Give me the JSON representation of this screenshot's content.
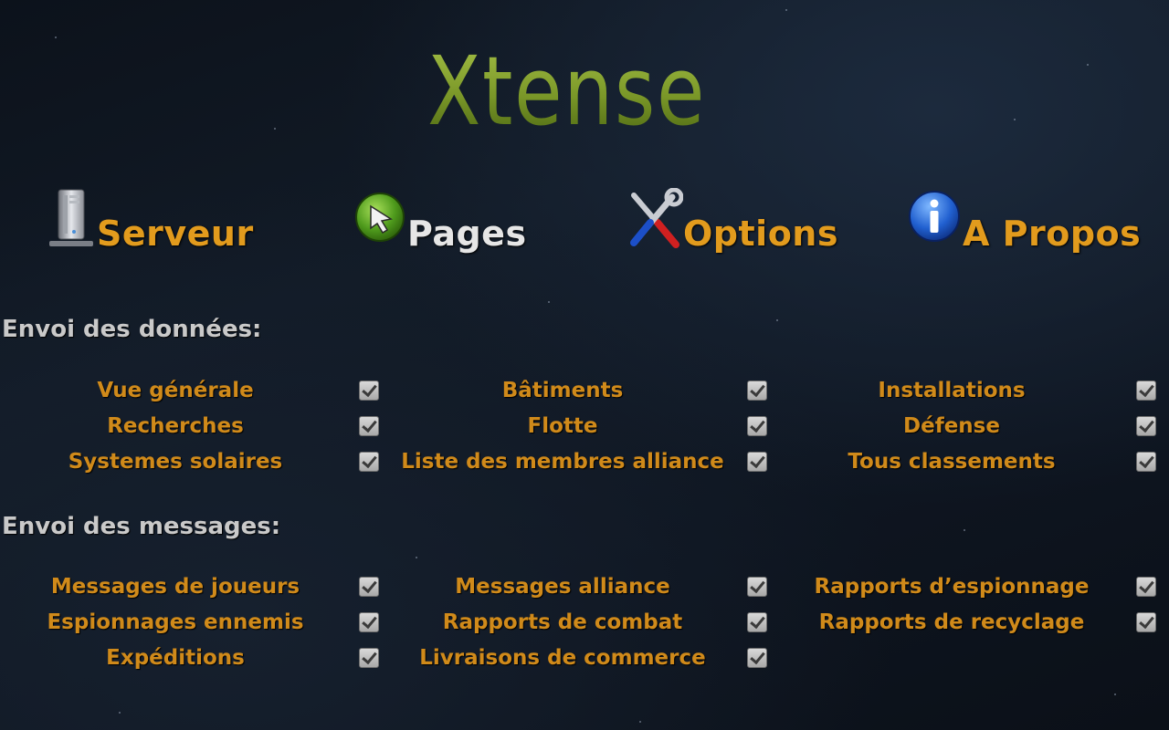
{
  "app": {
    "logo_text": "Xtense"
  },
  "nav": {
    "tabs": [
      {
        "label": "Serveur",
        "icon": "server-icon",
        "active": false
      },
      {
        "label": "Pages",
        "icon": "pages-icon",
        "active": true
      },
      {
        "label": "Options",
        "icon": "tools-icon",
        "active": false
      },
      {
        "label": "A Propos",
        "icon": "info-icon",
        "active": false
      }
    ]
  },
  "colors": {
    "accent": "#e29b1d",
    "option_label": "#d08a1a",
    "active_tab": "#e6e6e6",
    "section_title": "#c9c9c9",
    "logo": "#7e9a2c"
  },
  "sections": {
    "data": {
      "title": "Envoi des données:",
      "options": [
        {
          "label": "Vue générale",
          "checked": true
        },
        {
          "label": "Bâtiments",
          "checked": true
        },
        {
          "label": "Installations",
          "checked": true
        },
        {
          "label": "Recherches",
          "checked": true
        },
        {
          "label": "Flotte",
          "checked": true
        },
        {
          "label": "Défense",
          "checked": true
        },
        {
          "label": "Systemes solaires",
          "checked": true
        },
        {
          "label": "Liste des membres alliance",
          "checked": true
        },
        {
          "label": "Tous classements",
          "checked": true
        }
      ]
    },
    "messages": {
      "title": "Envoi des messages:",
      "options": [
        {
          "label": "Messages de joueurs",
          "checked": true
        },
        {
          "label": "Messages alliance",
          "checked": true
        },
        {
          "label": "Rapports d’espionnage",
          "checked": true
        },
        {
          "label": "Espionnages ennemis",
          "checked": true
        },
        {
          "label": "Rapports de combat",
          "checked": true
        },
        {
          "label": "Rapports de recyclage",
          "checked": true
        },
        {
          "label": "Expéditions",
          "checked": true
        },
        {
          "label": "Livraisons de commerce",
          "checked": true
        }
      ]
    }
  }
}
